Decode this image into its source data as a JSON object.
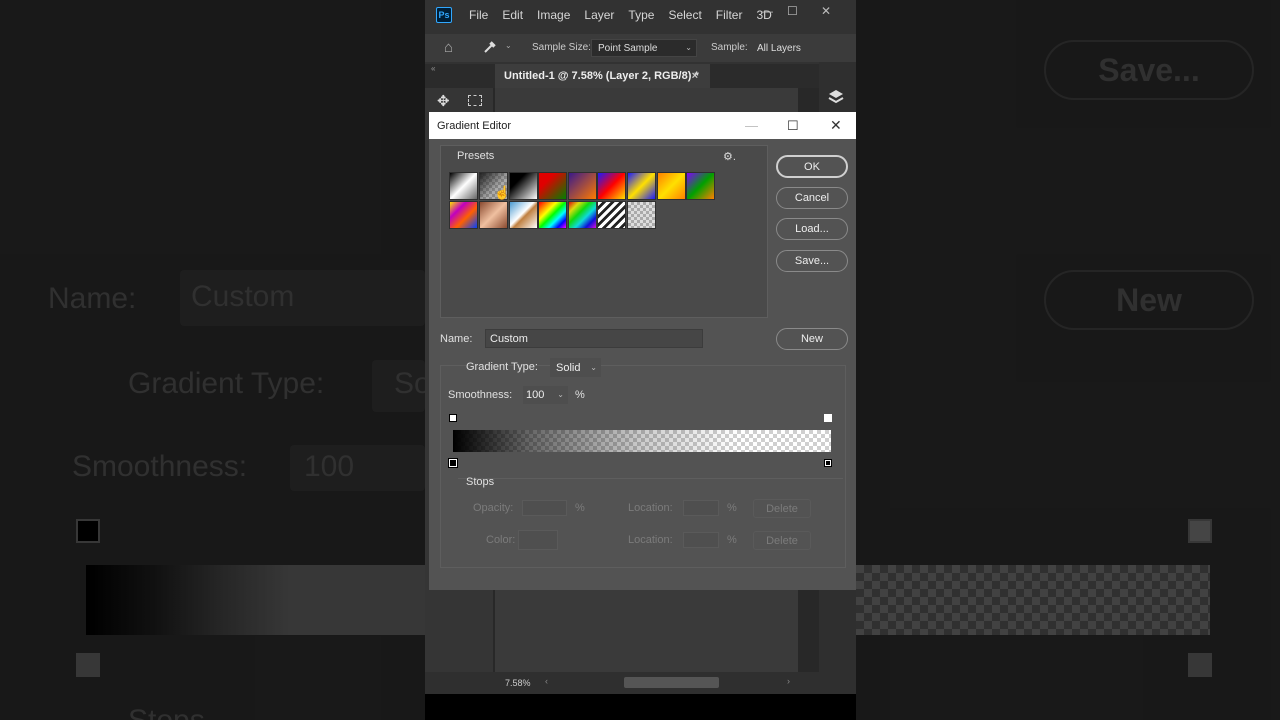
{
  "background": {
    "name_label": "Name:",
    "name_value": "Custom",
    "gradient_type_label": "Gradient Type:",
    "gradient_type_value": "So",
    "smoothness_label": "Smoothness:",
    "smoothness_value": "100",
    "save_label": "Save...",
    "new_label": "New",
    "stops_label": "Stops"
  },
  "menubar": {
    "items": [
      "File",
      "Edit",
      "Image",
      "Layer",
      "Type",
      "Select",
      "Filter",
      "3D"
    ],
    "logo": "Ps"
  },
  "options_bar": {
    "sample_size_label": "Sample Size:",
    "sample_size_value": "Point Sample",
    "sample_label": "Sample:",
    "sample_value": "All Layers"
  },
  "document_tab": {
    "title": "Untitled-1 @ 7.58% (Layer 2, RGB/8) *",
    "close": "×"
  },
  "status": {
    "zoom": "7.58%"
  },
  "dialog": {
    "title": "Gradient Editor",
    "presets_label": "Presets",
    "ok_label": "OK",
    "cancel_label": "Cancel",
    "load_label": "Load...",
    "save_label": "Save...",
    "name_label": "Name:",
    "name_value": "Custom",
    "new_label": "New",
    "gradient_type_label": "Gradient Type:",
    "gradient_type_value": "Solid",
    "smoothness_label": "Smoothness:",
    "smoothness_value": "100",
    "percent": "%",
    "stops_label": "Stops",
    "opacity_label": "Opacity:",
    "location_label": "Location:",
    "color_label": "Color:",
    "delete_label": "Delete"
  },
  "presets": [
    "black-white",
    "transparent-checker",
    "black-to-white",
    "red-green",
    "violet-orange",
    "blue-red-yellow",
    "blue-yellow-blue",
    "orange-yellow-orange",
    "violet-green-orange",
    "yellow-violet-orange-blue",
    "copper",
    "chrome",
    "spectrum",
    "transparent-rainbow",
    "transparent-stripes",
    "checker"
  ]
}
